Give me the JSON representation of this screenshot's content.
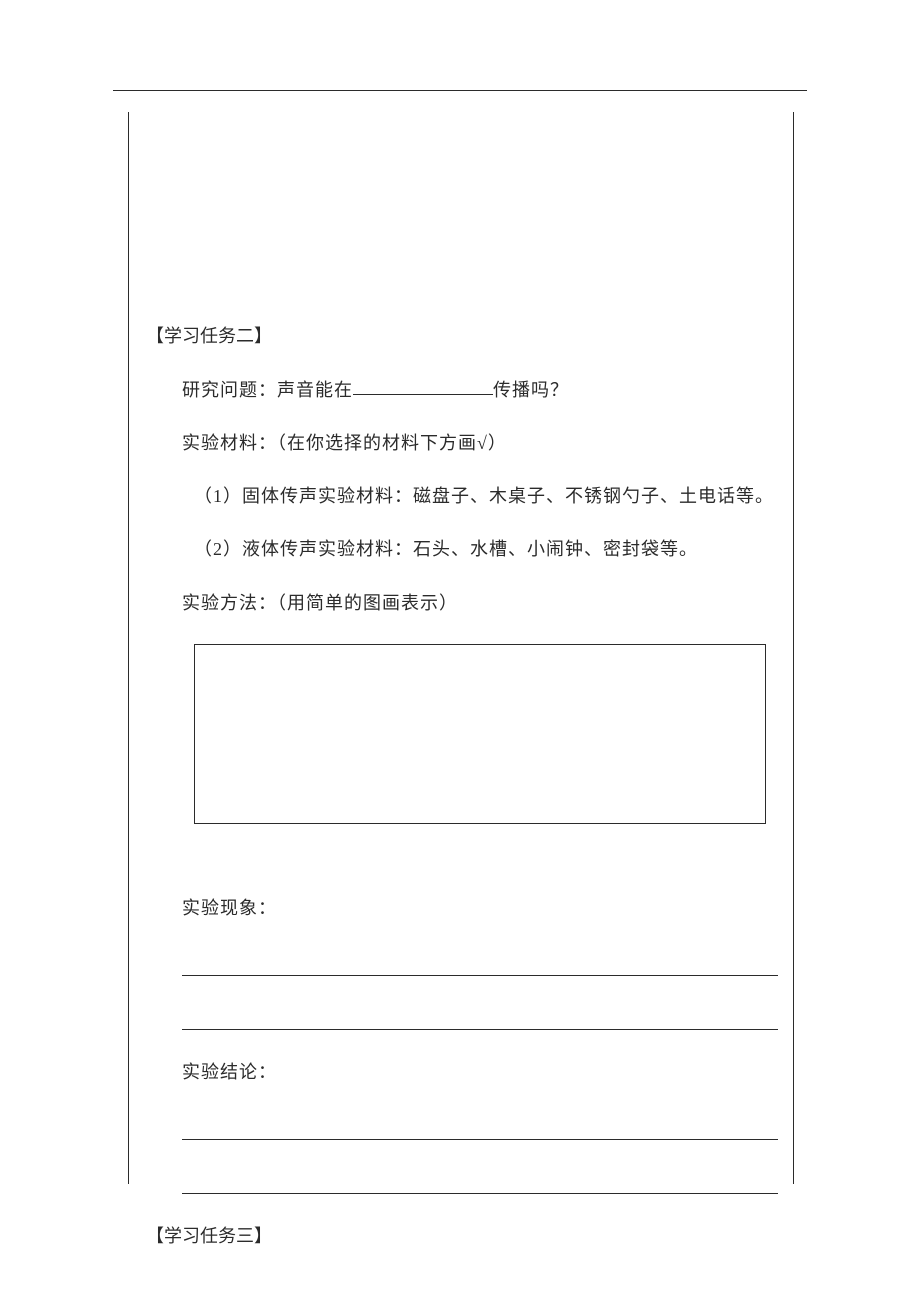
{
  "task2": {
    "heading": "【学习任务二】",
    "research_prefix": "研究问题：声音能在",
    "research_suffix": "传播吗？",
    "materials_label": "实验材料：（在你选择的材料下方画√）",
    "materials_1": "（1）固体传声实验材料：磁盘子、木桌子、不锈钢勺子、土电话等。",
    "materials_2": "（2）液体传声实验材料：石头、水槽、小闹钟、密封袋等。",
    "method_label": "实验方法：（用简单的图画表示）",
    "phenomenon_label": "实验现象：",
    "conclusion_label": "实验结论："
  },
  "task3": {
    "heading": "【学习任务三】"
  }
}
